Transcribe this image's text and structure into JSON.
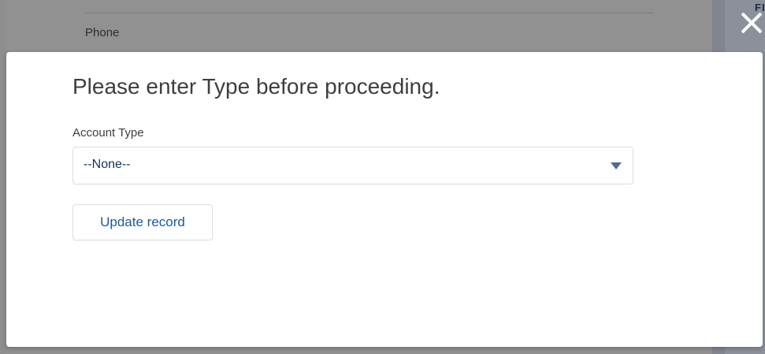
{
  "background": {
    "phone_label": "Phone",
    "right_panel_text": "FIN"
  },
  "modal": {
    "close_icon": "close-icon",
    "title": "Please enter Type before proceeding.",
    "field": {
      "label": "Account Type",
      "selected_value": "--None--",
      "arrow_icon": "chevron-down-icon"
    },
    "update_button_label": "Update record"
  },
  "colors": {
    "overlay": "#8e8e8e",
    "modal_background": "#ffffff",
    "title_text": "#3e3e3c",
    "button_text": "#1c5a9a",
    "border": "#d8dde6"
  }
}
